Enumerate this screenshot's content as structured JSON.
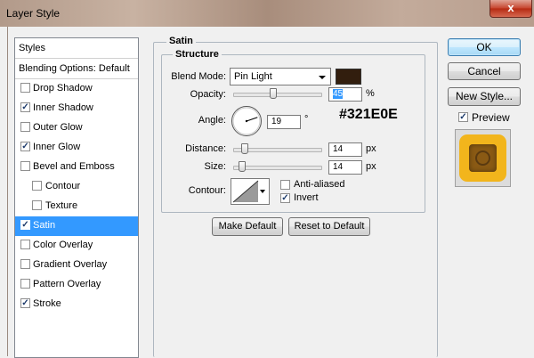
{
  "window": {
    "title": "Layer Style",
    "close_glyph": "x"
  },
  "styles_panel": {
    "header": "Styles",
    "blending_options": "Blending Options: Default",
    "items": [
      {
        "label": "Drop Shadow",
        "checked": false,
        "indent": false,
        "selected": false
      },
      {
        "label": "Inner Shadow",
        "checked": true,
        "indent": false,
        "selected": false
      },
      {
        "label": "Outer Glow",
        "checked": false,
        "indent": false,
        "selected": false
      },
      {
        "label": "Inner Glow",
        "checked": true,
        "indent": false,
        "selected": false
      },
      {
        "label": "Bevel and Emboss",
        "checked": false,
        "indent": false,
        "selected": false
      },
      {
        "label": "Contour",
        "checked": false,
        "indent": true,
        "selected": false
      },
      {
        "label": "Texture",
        "checked": false,
        "indent": true,
        "selected": false
      },
      {
        "label": "Satin",
        "checked": true,
        "indent": false,
        "selected": true
      },
      {
        "label": "Color Overlay",
        "checked": false,
        "indent": false,
        "selected": false
      },
      {
        "label": "Gradient Overlay",
        "checked": false,
        "indent": false,
        "selected": false
      },
      {
        "label": "Pattern Overlay",
        "checked": false,
        "indent": false,
        "selected": false
      },
      {
        "label": "Stroke",
        "checked": true,
        "indent": false,
        "selected": false
      }
    ]
  },
  "satin": {
    "title": "Satin",
    "structure_title": "Structure",
    "blend_mode_label": "Blend Mode:",
    "blend_mode_value": "Pin Light",
    "blend_color": "#321E0E",
    "color_caption": "#321E0E",
    "opacity_label": "Opacity:",
    "opacity_value": "45",
    "opacity_unit": "%",
    "opacity_fraction": 0.45,
    "angle_label": "Angle:",
    "angle_value": "19",
    "angle_unit": "°",
    "distance_label": "Distance:",
    "distance_value": "14",
    "distance_unit": "px",
    "size_label": "Size:",
    "size_value": "14",
    "size_unit": "px",
    "contour_label": "Contour:",
    "anti_aliased_label": "Anti-aliased",
    "anti_aliased_checked": false,
    "invert_label": "Invert",
    "invert_checked": true,
    "make_default_label": "Make Default",
    "reset_default_label": "Reset to Default"
  },
  "buttons": {
    "ok": "OK",
    "cancel": "Cancel",
    "new_style": "New Style...",
    "preview_label": "Preview",
    "preview_checked": true
  },
  "icons": {
    "close": "close-icon",
    "contour_dropdown": "chevron-down-icon",
    "angle_dial": "angle-dial-icon",
    "preview_swatch": "preview-swatch-icon"
  },
  "colors": {
    "selection": "#3399ff",
    "preview_gold": "#f2b51c",
    "preview_brown": "#8a5a14"
  }
}
